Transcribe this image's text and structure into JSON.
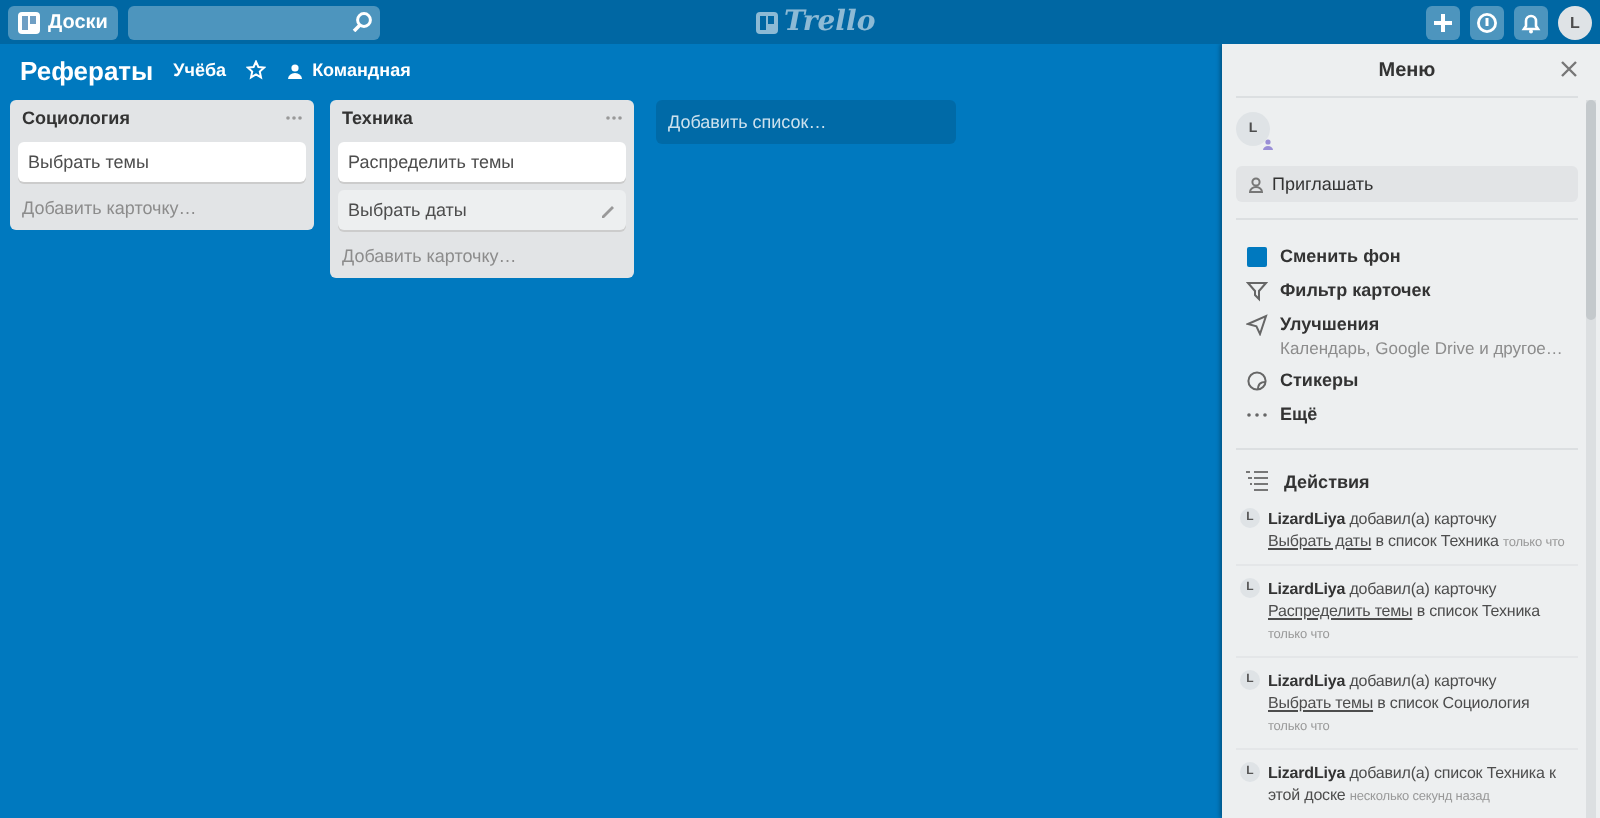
{
  "header": {
    "boards_button": "Доски",
    "logo": "Trello",
    "avatar": "L"
  },
  "board": {
    "title": "Рефераты",
    "team": "Учёба",
    "visibility": "Командная"
  },
  "lists": [
    {
      "title": "Социология",
      "cards": [
        {
          "text": "Выбрать темы",
          "hovered": false
        }
      ],
      "add_card": "Добавить карточку…"
    },
    {
      "title": "Техника",
      "cards": [
        {
          "text": "Распределить темы",
          "hovered": false
        },
        {
          "text": "Выбрать даты",
          "hovered": true
        }
      ],
      "add_card": "Добавить карточку…"
    }
  ],
  "add_list": "Добавить список…",
  "menu": {
    "title": "Меню",
    "member_avatar": "L",
    "invite": "Приглашать",
    "items": [
      {
        "kind": "background",
        "label": "Сменить фон",
        "color": "#0079bf"
      },
      {
        "kind": "filter",
        "label": "Фильтр карточек"
      },
      {
        "kind": "powerups",
        "label": "Улучшения",
        "sublabel": "Календарь, Google Drive и другое…"
      },
      {
        "kind": "stickers",
        "label": "Стикеры"
      },
      {
        "kind": "more",
        "label": "Ещё"
      }
    ],
    "activity_title": "Действия",
    "activity": [
      {
        "avatar": "L",
        "user": "LizardLiya",
        "before": "добавил(а) карточку",
        "link": "Выбрать даты",
        "after": "в список Техника",
        "time": "только что"
      },
      {
        "avatar": "L",
        "user": "LizardLiya",
        "before": "добавил(а) карточку",
        "link": "Распределить темы",
        "after": "в список Техника",
        "time": "только что"
      },
      {
        "avatar": "L",
        "user": "LizardLiya",
        "before": "добавил(а) карточку",
        "link": "Выбрать темы",
        "after": "в список Социология",
        "time": "только что"
      },
      {
        "avatar": "L",
        "user": "LizardLiya",
        "before": "добавил(а) список Техника к этой доске",
        "time": "несколько секунд назад"
      }
    ]
  }
}
